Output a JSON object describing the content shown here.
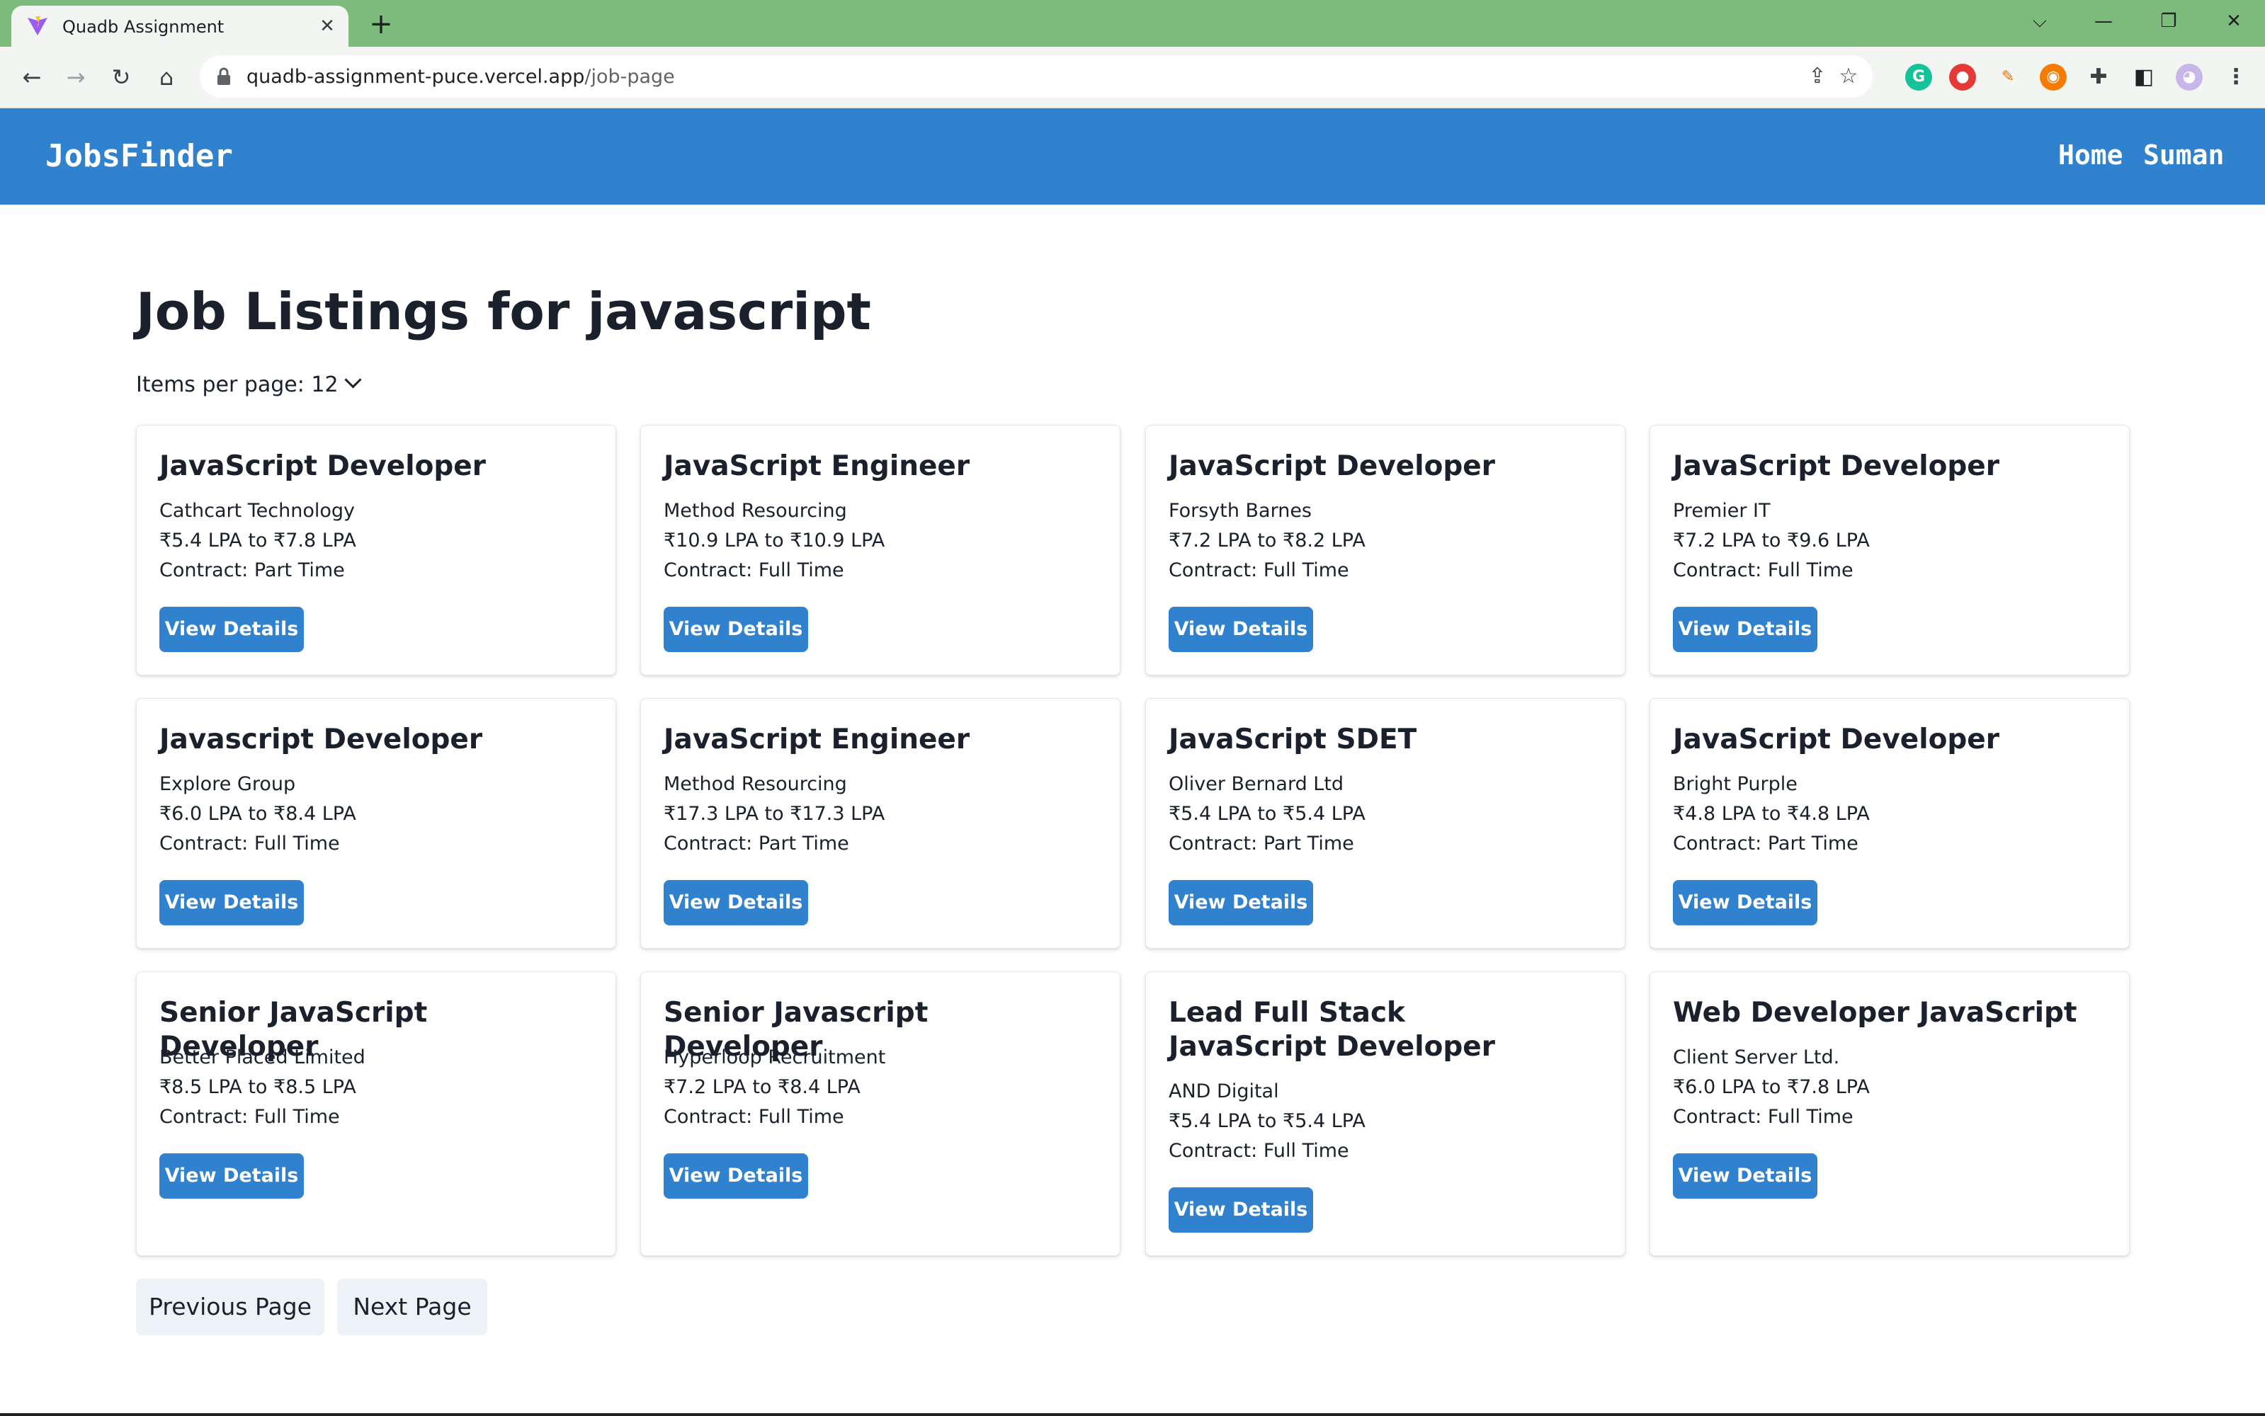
{
  "browser": {
    "tab_title": "Quadb Assignment",
    "url_host": "quadb-assignment-puce.vercel.app",
    "url_path": "/job-page"
  },
  "header": {
    "brand": "JobsFinder",
    "nav": [
      "Home",
      "Suman"
    ]
  },
  "main": {
    "title": "Job Listings for javascript",
    "items_per_page": "Items per page: 12"
  },
  "jobs": [
    {
      "title": "JavaScript Developer",
      "company": "Cathcart Technology",
      "salary": "₹5.4 LPA to ₹7.8 LPA",
      "contract": "Contract: Part Time",
      "button": "View Details"
    },
    {
      "title": "JavaScript Engineer",
      "company": "Method Resourcing",
      "salary": "₹10.9 LPA to ₹10.9 LPA",
      "contract": "Contract: Full Time",
      "button": "View Details"
    },
    {
      "title": "JavaScript Developer",
      "company": "Forsyth Barnes",
      "salary": "₹7.2 LPA to ₹8.2 LPA",
      "contract": "Contract: Full Time",
      "button": "View Details"
    },
    {
      "title": "JavaScript Developer",
      "company": "Premier IT",
      "salary": "₹7.2 LPA to ₹9.6 LPA",
      "contract": "Contract: Full Time",
      "button": "View Details"
    },
    {
      "title": "Javascript Developer",
      "company": "Explore Group",
      "salary": "₹6.0 LPA to ₹8.4 LPA",
      "contract": "Contract: Full Time",
      "button": "View Details"
    },
    {
      "title": "JavaScript Engineer",
      "company": "Method Resourcing",
      "salary": "₹17.3 LPA to ₹17.3 LPA",
      "contract": "Contract: Part Time",
      "button": "View Details"
    },
    {
      "title": "JavaScript SDET",
      "company": "Oliver Bernard Ltd",
      "salary": "₹5.4 LPA to ₹5.4 LPA",
      "contract": "Contract: Part Time",
      "button": "View Details"
    },
    {
      "title": "JavaScript Developer",
      "company": "Bright Purple",
      "salary": "₹4.8 LPA to ₹4.8 LPA",
      "contract": "Contract: Part Time",
      "button": "View Details"
    },
    {
      "title": "Senior JavaScript Developer",
      "company": "Better Placed Limited",
      "salary": "₹8.5 LPA to ₹8.5 LPA",
      "contract": "Contract: Full Time",
      "button": "View Details"
    },
    {
      "title": "Senior Javascript Developer",
      "company": "Hyperloop Recruitment",
      "salary": "₹7.2 LPA to ₹8.4 LPA",
      "contract": "Contract: Full Time",
      "button": "View Details"
    },
    {
      "title": "Lead Full Stack JavaScript Developer",
      "company": "AND Digital",
      "salary": "₹5.4 LPA to ₹5.4 LPA",
      "contract": "Contract: Full Time",
      "button": "View Details"
    },
    {
      "title": "Web Developer JavaScript",
      "company": "Client Server Ltd.",
      "salary": "₹6.0 LPA to ₹7.8 LPA",
      "contract": "Contract: Full Time",
      "button": "View Details"
    }
  ],
  "pagination": {
    "previous": "Previous Page",
    "next": "Next Page"
  }
}
